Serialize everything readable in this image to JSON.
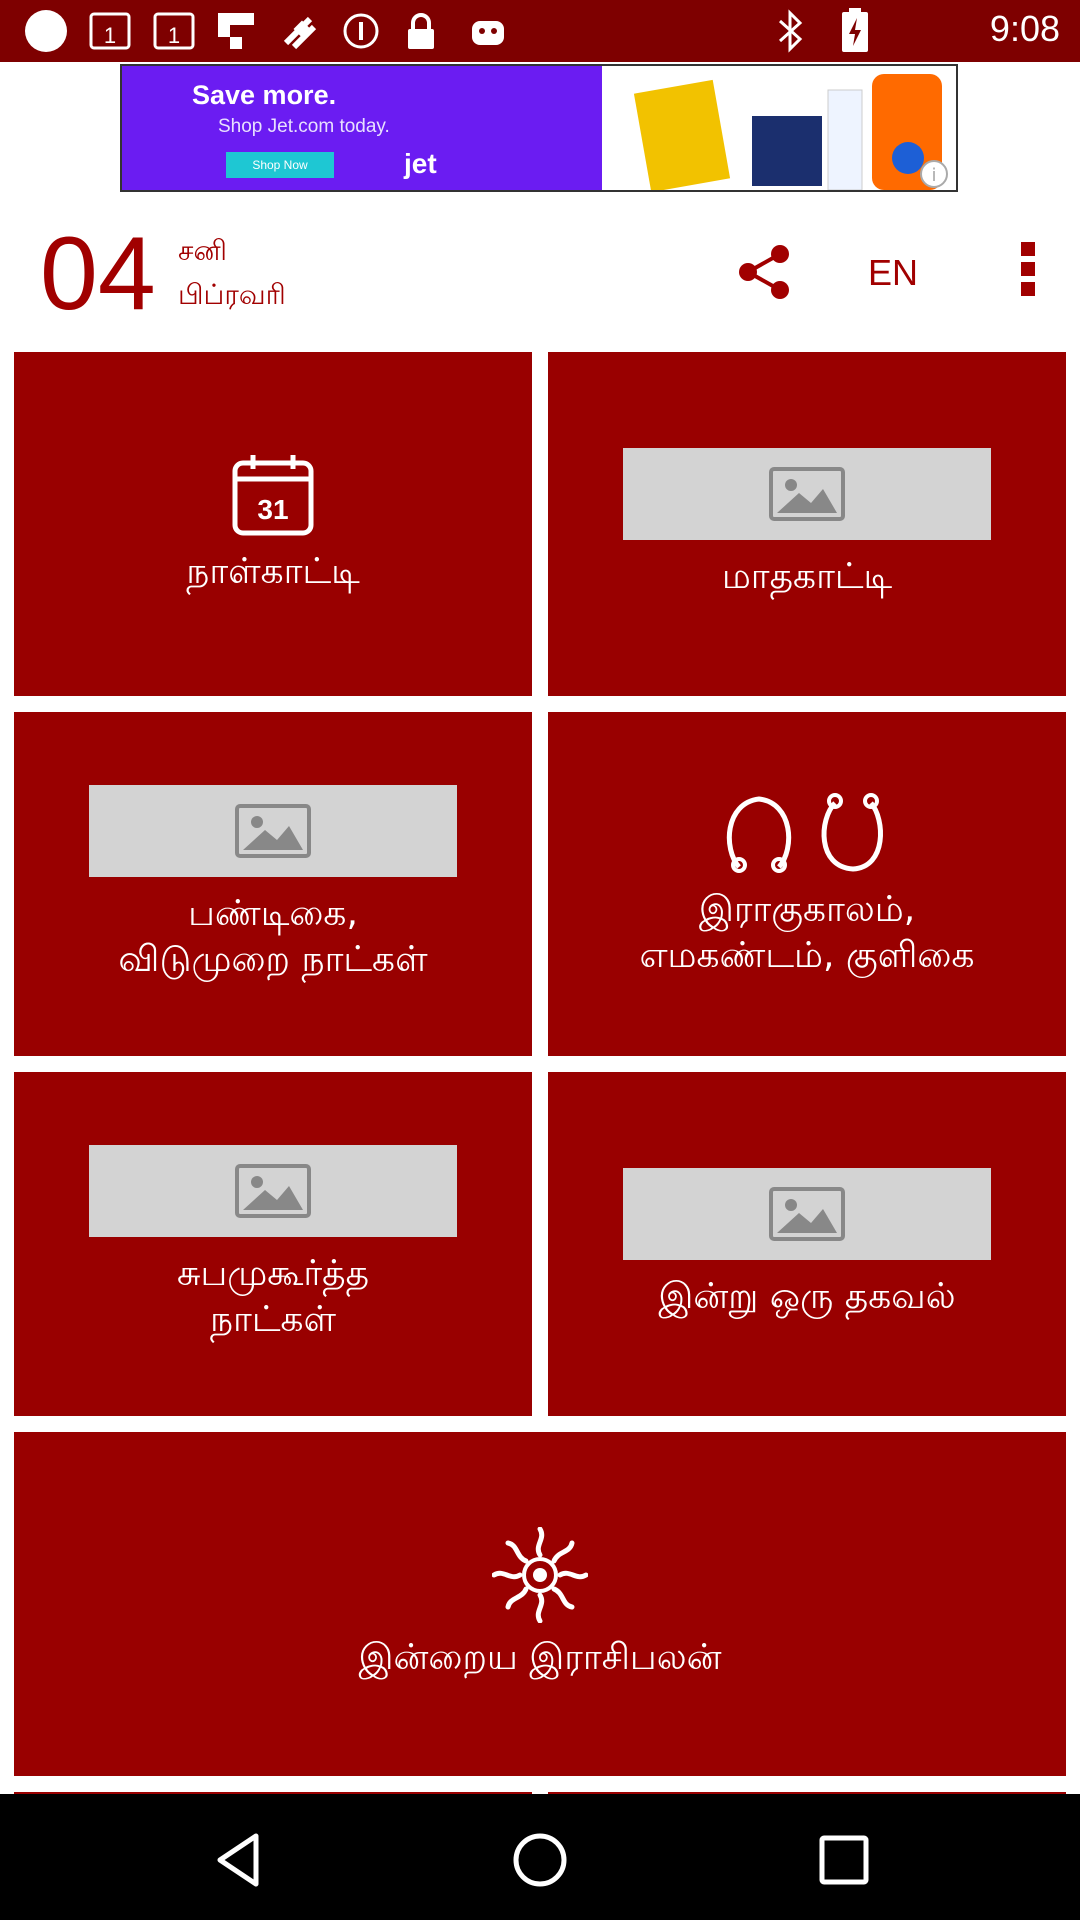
{
  "status_bar": {
    "time": "9:08",
    "icons": [
      "circle-notification-icon",
      "calendar-1-icon",
      "calendar-1-icon",
      "flipboard-icon",
      "fake-gps-icon",
      "info-circle-icon",
      "lock-icon",
      "android-icon",
      "bluetooth-icon",
      "battery-charging-icon"
    ]
  },
  "ad": {
    "title": "Save more.",
    "subtitle": "Shop Jet.com today.",
    "cta": "Shop Now",
    "brand": "jet"
  },
  "header": {
    "date_number": "04",
    "day_name": "சனி",
    "month_name": "பிப்ரவரி",
    "language": "EN"
  },
  "tiles": [
    {
      "label": "நாள்காட்டி",
      "icon": "calendar-31-icon"
    },
    {
      "label": "மாதகாட்டி",
      "icon": "image-placeholder-icon"
    },
    {
      "label": "பண்டிகை,\nவிடுமுறை  நாட்கள்",
      "icon": "image-placeholder-icon"
    },
    {
      "label": "இராகுகாலம்,\nஎமகண்டம்,  குளிகை",
      "icon": "rahu-kalam-icon"
    },
    {
      "label": "சுபமுகூர்த்த\nநாட்கள்",
      "icon": "image-placeholder-icon"
    },
    {
      "label": "இன்று  ஒரு  தகவல்",
      "icon": "image-placeholder-icon"
    },
    {
      "label": "இன்றைய  இராசிபலன்",
      "icon": "sun-icon"
    }
  ],
  "colors": {
    "accent": "#990000",
    "status_bar": "#7e0000",
    "placeholder": "#d3d3d3"
  }
}
